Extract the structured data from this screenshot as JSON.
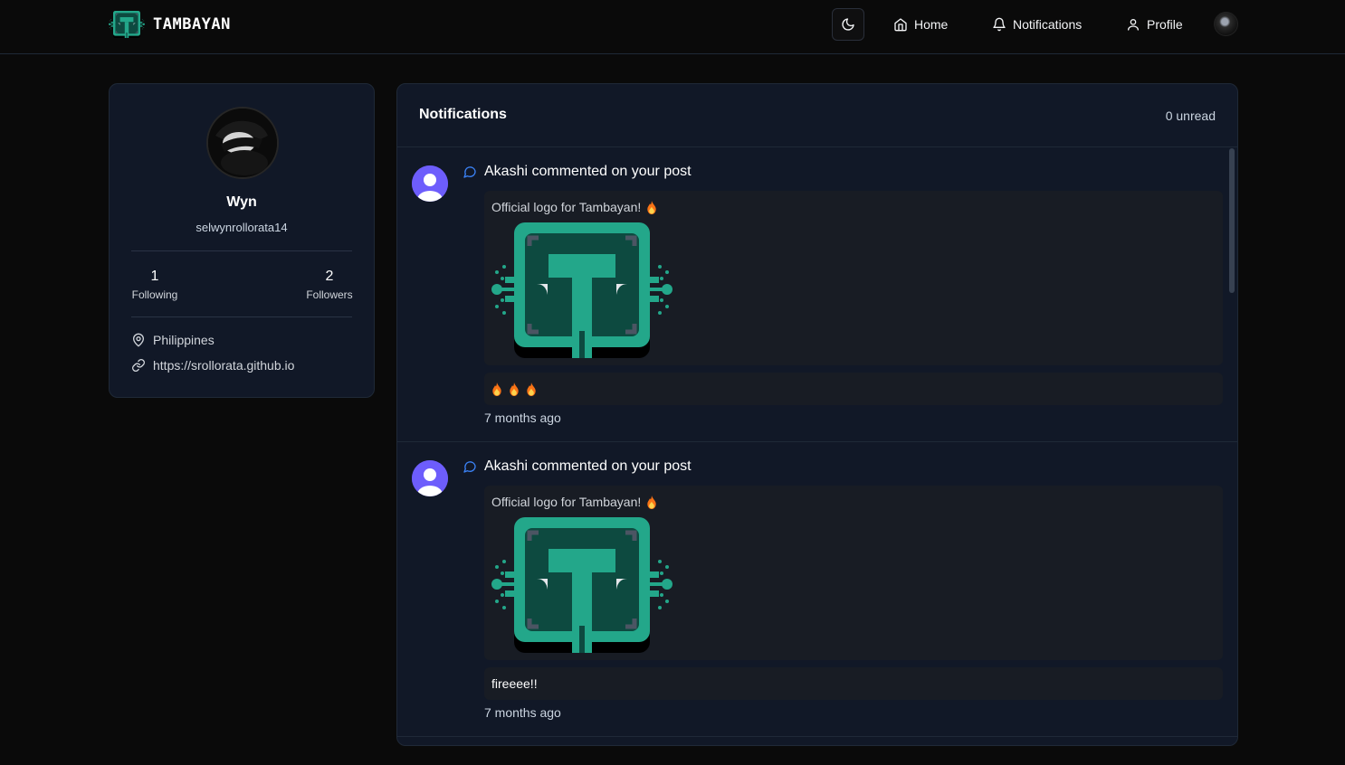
{
  "nav": {
    "brand": "TAMBAYAN",
    "home": "Home",
    "notifications": "Notifications",
    "profile": "Profile"
  },
  "profile": {
    "name": "Wyn",
    "username": "selwynrollorata14",
    "following_count": "1",
    "following_label": "Following",
    "followers_count": "2",
    "followers_label": "Followers",
    "location": "Philippines",
    "website": "https://srollorata.github.io"
  },
  "notifications_panel": {
    "title": "Notifications",
    "unread": "0 unread",
    "items": [
      {
        "title": "Akashi commented on your post",
        "post_text": "Official logo for Tambayan!",
        "comment": "🔥🔥🔥",
        "time": "7 months ago"
      },
      {
        "title": "Akashi commented on your post",
        "post_text": "Official logo for Tambayan!",
        "comment": "fireeee!!",
        "time": "7 months ago"
      }
    ]
  },
  "colors": {
    "brand_teal": "#23a78a",
    "brand_dark_teal": "#0d4a40",
    "accent_blue": "#3b82f6",
    "avatar_purple": "#6d5dfc",
    "panel_bg": "#111827",
    "page_bg": "#0a0a0a"
  },
  "icons": {
    "theme_toggle": "moon-icon",
    "home": "home-icon",
    "notifications": "bell-icon",
    "profile": "user-icon",
    "location": "map-pin-icon",
    "website": "link-icon",
    "comment": "message-circle-icon",
    "reaction": "fire-icon"
  }
}
